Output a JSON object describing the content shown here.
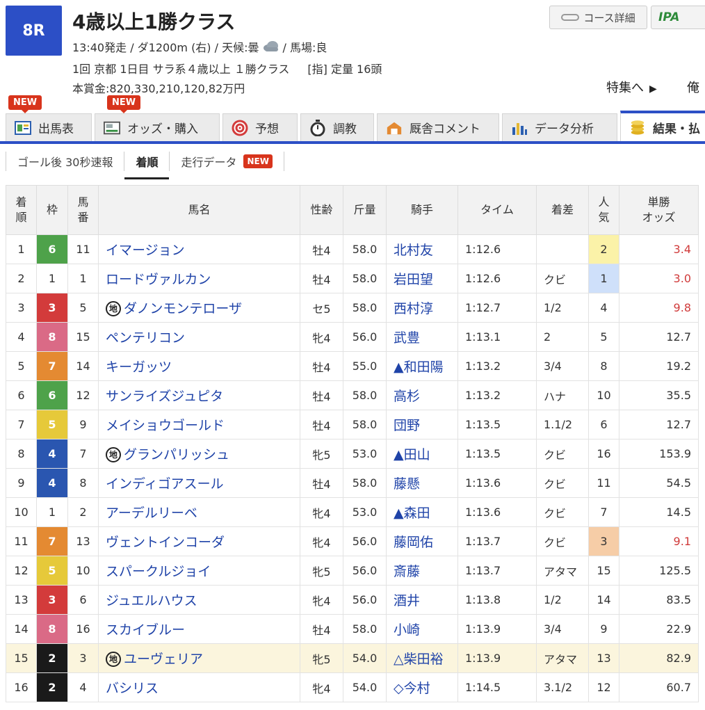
{
  "race": {
    "number": "8R",
    "title": "4歳以上1勝クラス",
    "meta_before_icon": "13:40発走 / ダ1200m (右) / 天候:曇",
    "meta_after_icon": "/ 馬場:良",
    "weather_icon": "cloud-icon",
    "conditions": "1回 京都 1日目 サラ系４歳以上 １勝クラス",
    "conditions_extra": "[指] 定量 16頭",
    "prize": "本賞金:820,330,210,120,82万円"
  },
  "header_buttons": {
    "course_label": "コース詳細",
    "ipat_label": "IPA"
  },
  "feature_link": {
    "label": "特集へ",
    "next_label": "俺"
  },
  "badges": {
    "new": "NEW"
  },
  "tabs": [
    {
      "label": "出馬表",
      "icon": "racecard-icon",
      "active": false
    },
    {
      "label": "オッズ・購入",
      "icon": "ipat-icon",
      "active": false
    },
    {
      "label": "予想",
      "icon": "target-icon",
      "active": false
    },
    {
      "label": "調教",
      "icon": "stopwatch-icon",
      "active": false
    },
    {
      "label": "厩舎コメント",
      "icon": "stable-icon",
      "active": false
    },
    {
      "label": "データ分析",
      "icon": "bar-chart-icon",
      "active": false
    },
    {
      "label": "結果・払",
      "icon": "coins-icon",
      "active": true
    }
  ],
  "subtabs": [
    {
      "label": "ゴール後 30秒速報",
      "active": false
    },
    {
      "label": "着順",
      "active": true
    },
    {
      "label": "走行データ",
      "active": false,
      "new": true
    }
  ],
  "table": {
    "headers": {
      "rank": "着\n順",
      "waku": "枠",
      "umaban": "馬\n番",
      "name": "馬名",
      "sexage": "性齢",
      "weight": "斤量",
      "jockey": "騎手",
      "time": "タイム",
      "margin": "着差",
      "pop": "人\n気",
      "odds": "単勝\nオッズ"
    },
    "local_mark": "地",
    "rows": [
      {
        "rank": "1",
        "waku": "6",
        "umaban": "11",
        "name": "イマージョン",
        "local": false,
        "sexage": "牡4",
        "weight": "58.0",
        "jockey": "北村友",
        "time": "1:12.6",
        "margin": "",
        "pop": "2",
        "odds": "3.4"
      },
      {
        "rank": "2",
        "waku": "1",
        "umaban": "1",
        "name": "ロードヴァルカン",
        "local": false,
        "sexage": "牡4",
        "weight": "58.0",
        "jockey": "岩田望",
        "time": "1:12.6",
        "margin": "クビ",
        "pop": "1",
        "odds": "3.0"
      },
      {
        "rank": "3",
        "waku": "3",
        "umaban": "5",
        "name": "ダノンモンテローザ",
        "local": true,
        "sexage": "セ5",
        "weight": "58.0",
        "jockey": "西村淳",
        "time": "1:12.7",
        "margin": "1/2",
        "pop": "4",
        "odds": "9.8"
      },
      {
        "rank": "4",
        "waku": "8",
        "umaban": "15",
        "name": "ペンテリコン",
        "local": false,
        "sexage": "牝4",
        "weight": "56.0",
        "jockey": "武豊",
        "time": "1:13.1",
        "margin": "2",
        "pop": "5",
        "odds": "12.7"
      },
      {
        "rank": "5",
        "waku": "7",
        "umaban": "14",
        "name": "キーガッツ",
        "local": false,
        "sexage": "牡4",
        "weight": "55.0",
        "jockey": "▲和田陽",
        "time": "1:13.2",
        "margin": "3/4",
        "pop": "8",
        "odds": "19.2"
      },
      {
        "rank": "6",
        "waku": "6",
        "umaban": "12",
        "name": "サンライズジュピタ",
        "local": false,
        "sexage": "牡4",
        "weight": "58.0",
        "jockey": "高杉",
        "time": "1:13.2",
        "margin": "ハナ",
        "pop": "10",
        "odds": "35.5"
      },
      {
        "rank": "7",
        "waku": "5",
        "umaban": "9",
        "name": "メイショウゴールド",
        "local": false,
        "sexage": "牡4",
        "weight": "58.0",
        "jockey": "団野",
        "time": "1:13.5",
        "margin": "1.1/2",
        "pop": "6",
        "odds": "12.7"
      },
      {
        "rank": "8",
        "waku": "4",
        "umaban": "7",
        "name": "グランパリッシュ",
        "local": true,
        "sexage": "牝5",
        "weight": "53.0",
        "jockey": "▲田山",
        "time": "1:13.5",
        "margin": "クビ",
        "pop": "16",
        "odds": "153.9"
      },
      {
        "rank": "9",
        "waku": "4",
        "umaban": "8",
        "name": "インディゴアスール",
        "local": false,
        "sexage": "牡4",
        "weight": "58.0",
        "jockey": "藤懸",
        "time": "1:13.6",
        "margin": "クビ",
        "pop": "11",
        "odds": "54.5"
      },
      {
        "rank": "10",
        "waku": "1",
        "umaban": "2",
        "name": "アーデルリーベ",
        "local": false,
        "sexage": "牝4",
        "weight": "53.0",
        "jockey": "▲森田",
        "time": "1:13.6",
        "margin": "クビ",
        "pop": "7",
        "odds": "14.5"
      },
      {
        "rank": "11",
        "waku": "7",
        "umaban": "13",
        "name": "ヴェントインコーダ",
        "local": false,
        "sexage": "牝4",
        "weight": "56.0",
        "jockey": "藤岡佑",
        "time": "1:13.7",
        "margin": "クビ",
        "pop": "3",
        "odds": "9.1"
      },
      {
        "rank": "12",
        "waku": "5",
        "umaban": "10",
        "name": "スパークルジョイ",
        "local": false,
        "sexage": "牝5",
        "weight": "56.0",
        "jockey": "斎藤",
        "time": "1:13.7",
        "margin": "アタマ",
        "pop": "15",
        "odds": "125.5"
      },
      {
        "rank": "13",
        "waku": "3",
        "umaban": "6",
        "name": "ジュエルハウス",
        "local": false,
        "sexage": "牝4",
        "weight": "56.0",
        "jockey": "酒井",
        "time": "1:13.8",
        "margin": "1/2",
        "pop": "14",
        "odds": "83.5"
      },
      {
        "rank": "14",
        "waku": "8",
        "umaban": "16",
        "name": "スカイブルー",
        "local": false,
        "sexage": "牡4",
        "weight": "58.0",
        "jockey": "小崎",
        "time": "1:13.9",
        "margin": "3/4",
        "pop": "9",
        "odds": "22.9"
      },
      {
        "rank": "15",
        "waku": "2",
        "umaban": "3",
        "name": "ユーヴェリア",
        "local": true,
        "sexage": "牝5",
        "weight": "54.0",
        "jockey": "△柴田裕",
        "time": "1:13.9",
        "margin": "アタマ",
        "pop": "13",
        "odds": "82.9",
        "highlight": true
      },
      {
        "rank": "16",
        "waku": "2",
        "umaban": "4",
        "name": "バシリス",
        "local": false,
        "sexage": "牝4",
        "weight": "54.0",
        "jockey": "◇今村",
        "time": "1:14.5",
        "margin": "3.1/2",
        "pop": "12",
        "odds": "60.7"
      }
    ]
  },
  "colors": {
    "accent": "#2c4fc6",
    "new_badge": "#d8341c",
    "link": "#1f43a8",
    "hot_odds": "#d03a3a",
    "waku": {
      "1": {
        "bg": "#ffffff",
        "fg": "#333333"
      },
      "2": {
        "bg": "#1a1a1a",
        "fg": "#ffffff"
      },
      "3": {
        "bg": "#d33b3b",
        "fg": "#ffffff"
      },
      "4": {
        "bg": "#2a56b0",
        "fg": "#ffffff"
      },
      "5": {
        "bg": "#e6c93a",
        "fg": "#ffffff"
      },
      "6": {
        "bg": "#4ea24a",
        "fg": "#ffffff"
      },
      "7": {
        "bg": "#e48a32",
        "fg": "#ffffff"
      },
      "8": {
        "bg": "#da6a86",
        "fg": "#ffffff"
      }
    }
  }
}
